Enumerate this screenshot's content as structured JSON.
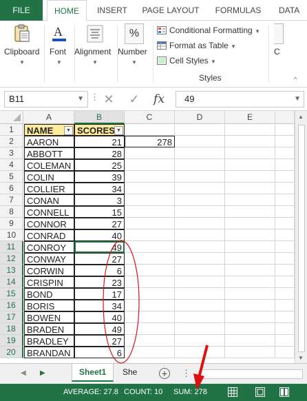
{
  "ribbon": {
    "tabs": [
      {
        "label": "FILE"
      },
      {
        "label": "HOME"
      },
      {
        "label": "INSERT"
      },
      {
        "label": "PAGE LAYOUT"
      },
      {
        "label": "FORMULAS"
      },
      {
        "label": "DATA"
      }
    ],
    "groups": {
      "clipboard": "Clipboard",
      "font": "Font",
      "alignment": "Alignment",
      "number": "Number",
      "number_symbol": "%"
    },
    "styles": {
      "conditional_formatting": "Conditional Formatting",
      "format_as_table": "Format as Table",
      "cell_styles": "Cell Styles",
      "group_label": "Styles",
      "cells_partial": "C"
    },
    "accent_color": "#217346"
  },
  "formula_bar": {
    "name_box": "B11",
    "cancel_symbol": "✕",
    "enter_symbol": "✓",
    "fx_label": "fx",
    "value": "49"
  },
  "grid": {
    "columns": [
      "A",
      "B",
      "C",
      "D",
      "E"
    ],
    "header_row": {
      "name": "NAME",
      "scores": "SCORES"
    },
    "rows": [
      {
        "num": "1"
      },
      {
        "num": "2",
        "name": "AARON",
        "score": "21"
      },
      {
        "num": "3",
        "name": "ABBOTT",
        "score": "28"
      },
      {
        "num": "4",
        "name": "COLEMAN",
        "score": "25"
      },
      {
        "num": "5",
        "name": "COLIN",
        "score": "39"
      },
      {
        "num": "6",
        "name": "COLLIER",
        "score": "34"
      },
      {
        "num": "7",
        "name": "CONAN",
        "score": "3"
      },
      {
        "num": "8",
        "name": "CONNELL",
        "score": "15"
      },
      {
        "num": "9",
        "name": "CONNOR",
        "score": "27"
      },
      {
        "num": "10",
        "name": "CONRAD",
        "score": "40"
      },
      {
        "num": "11",
        "name": "CONROY",
        "score": "49"
      },
      {
        "num": "12",
        "name": "CONWAY",
        "score": "27"
      },
      {
        "num": "13",
        "name": "CORWIN",
        "score": "6"
      },
      {
        "num": "14",
        "name": "CRISPIN",
        "score": "23"
      },
      {
        "num": "15",
        "name": "BOND",
        "score": "17"
      },
      {
        "num": "16",
        "name": "BORIS",
        "score": "34"
      },
      {
        "num": "17",
        "name": "BOWEN",
        "score": "40"
      },
      {
        "num": "18",
        "name": "BRADEN",
        "score": "49"
      },
      {
        "num": "19",
        "name": "BRADLEY",
        "score": "27"
      },
      {
        "num": "20",
        "name": "BRANDAN",
        "score": "6"
      }
    ],
    "c2_value": "278",
    "selected_cell": "B11",
    "selected_range": "B11:B20"
  },
  "sheets": {
    "tabs": [
      "Sheet1",
      "She"
    ],
    "add_symbol": "+",
    "more_symbol": "⋮"
  },
  "status_bar": {
    "average": "AVERAGE: 27.8",
    "count": "COUNT: 10",
    "sum": "SUM: 278"
  },
  "annotations": {
    "ellipse_color": "#e01010",
    "arrow_color": "#e01010"
  }
}
